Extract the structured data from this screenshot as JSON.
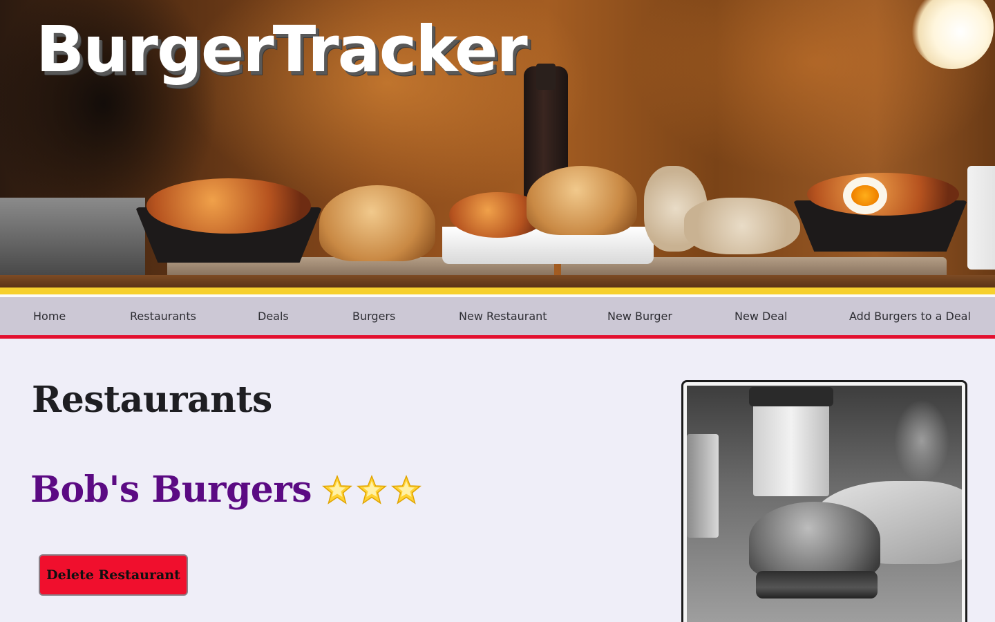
{
  "header": {
    "brand": "BurgerTracker"
  },
  "nav": {
    "items": [
      {
        "label": "Home"
      },
      {
        "label": "Restaurants"
      },
      {
        "label": "Deals"
      },
      {
        "label": "Burgers"
      },
      {
        "label": "New Restaurant"
      },
      {
        "label": "New Burger"
      },
      {
        "label": "New Deal"
      },
      {
        "label": "Add Burgers to a Deal"
      }
    ]
  },
  "main": {
    "title": "Restaurants",
    "restaurant": {
      "name": "Bob's Burgers",
      "rating": 3,
      "rating_icon": "star-emoji-icon"
    },
    "delete_label": "Delete Restaurant"
  },
  "colors": {
    "accent_purple": "#5b0a83",
    "danger_red": "#f00f2d",
    "nav_yellow": "#f6d02e",
    "nav_red": "#e3102f",
    "nav_bg": "#ccc8d5",
    "page_bg": "#efeef8"
  }
}
